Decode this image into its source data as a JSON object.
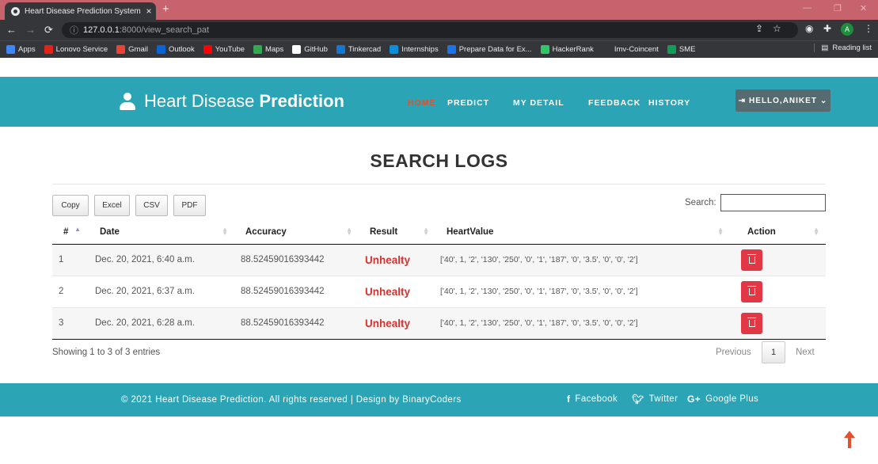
{
  "browser": {
    "tab_title": "Heart Disease Prediction System",
    "tab_close": "×",
    "new_tab": "+",
    "url_host": "127.0.0.1",
    "url_path": ":8000/view_search_pat",
    "profile_initial": "A",
    "bookmarks": [
      {
        "label": "Apps",
        "icon": "apps-grid-icon",
        "color": "#4285f4"
      },
      {
        "label": "Lonovo Service",
        "icon": "lenovo-icon",
        "color": "#e2231a"
      },
      {
        "label": "Gmail",
        "icon": "gmail-icon",
        "color": "#ea4335"
      },
      {
        "label": "Outlook",
        "icon": "outlook-icon",
        "color": "#0a64d6"
      },
      {
        "label": "YouTube",
        "icon": "youtube-icon",
        "color": "#ff0000"
      },
      {
        "label": "Maps",
        "icon": "maps-icon",
        "color": "#34a853"
      },
      {
        "label": "GitHub",
        "icon": "github-icon",
        "color": "#ffffff"
      },
      {
        "label": "Tinkercad",
        "icon": "tinkercad-icon",
        "color": "#1477d4"
      },
      {
        "label": "Internships",
        "icon": "internshala-icon",
        "color": "#0a8fd8"
      },
      {
        "label": "Prepare Data for Ex...",
        "icon": "coursera-icon",
        "color": "#1a73e8"
      },
      {
        "label": "HackerRank",
        "icon": "hackerrank-icon",
        "color": "#2ec866"
      },
      {
        "label": "Imv-Coincent",
        "icon": "blank-icon",
        "color": "#35363a"
      },
      {
        "label": "SME",
        "icon": "sheets-icon",
        "color": "#0f9d58"
      }
    ],
    "reading_list": "Reading list"
  },
  "header": {
    "brand_light": "Heart Disease",
    "brand_bold": "Prediction",
    "nav": [
      "HOME",
      "PREDICT",
      "MY DETAIL",
      "FEEDBACK",
      "HISTORY"
    ],
    "user": "HELLO,ANIKET",
    "accent": "#2ba4b6",
    "active_color": "#e4502c"
  },
  "page": {
    "title": "SEARCH LOGS",
    "buttons": [
      "Copy",
      "Excel",
      "CSV",
      "PDF"
    ],
    "search_label": "Search:",
    "columns": [
      "#",
      "Date",
      "Accuracy",
      "Result",
      "HeartValue",
      "Action"
    ],
    "rows": [
      {
        "num": "1",
        "date": "Dec. 20, 2021, 6:40 a.m.",
        "accuracy": "88.52459016393442",
        "result": "Unhealty",
        "heart": "['40', 1, '2', '130', '250', '0', '1', '187', '0', '3.5', '0', '0', '2']"
      },
      {
        "num": "2",
        "date": "Dec. 20, 2021, 6:37 a.m.",
        "accuracy": "88.52459016393442",
        "result": "Unhealty",
        "heart": "['40', 1, '2', '130', '250', '0', '1', '187', '0', '3.5', '0', '0', '2']"
      },
      {
        "num": "3",
        "date": "Dec. 20, 2021, 6:28 a.m.",
        "accuracy": "88.52459016393442",
        "result": "Unhealty",
        "heart": "['40', 1, '2', '130', '250', '0', '1', '187', '0', '3.5', '0', '0', '2']"
      }
    ],
    "info": "Showing 1 to 3 of 3 entries",
    "previous": "Previous",
    "page_num": "1",
    "next": "Next"
  },
  "footer": {
    "copyright": "© 2021 Heart Disease Prediction. All rights reserved | Design by BinaryCoders",
    "facebook": "Facebook",
    "twitter": "Twitter",
    "google": "Google Plus"
  }
}
